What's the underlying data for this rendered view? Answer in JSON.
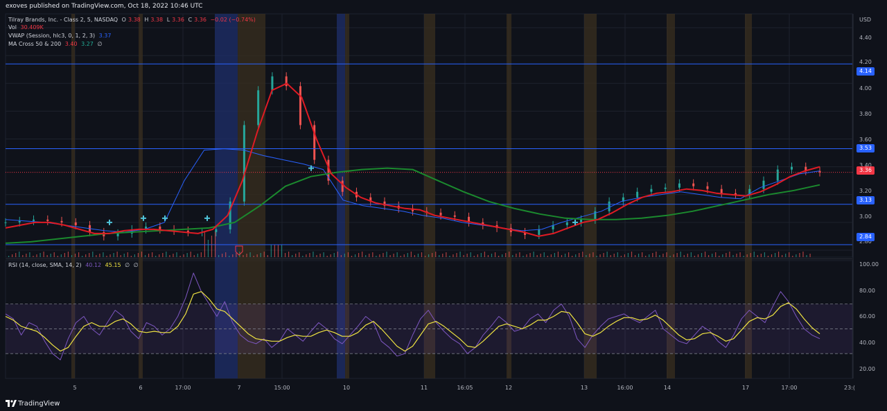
{
  "header": {
    "published": "exoves published on TradingView.com, Oct 18, 2022 10:46 UTC"
  },
  "legend": {
    "symbol": "Tilray Brands, Inc. - Class 2, 5, NASDAQ",
    "ohlc": {
      "o_label": "O",
      "o": "3.38",
      "h_label": "H",
      "h": "3.38",
      "l_label": "L",
      "l": "3.36",
      "c_label": "C",
      "c": "3.36",
      "change": "−0.02 (−0.74%)"
    },
    "vol_label": "Vol",
    "vol_value": "30.409K",
    "vwap_label": "VWAP (Session, hlc3, 0, 1, 2, 3)",
    "vwap_value": "3.37",
    "ma_label": "MA Cross 50 & 200",
    "ma_fast": "3.40",
    "ma_slow": "3.27",
    "ma_extra": "∅",
    "rsi_label": "RSI (14, close, SMA, 14, 2)",
    "rsi_value": "40.12",
    "rsi_ma": "45.15",
    "rsi_extra1": "∅",
    "rsi_extra2": "∅"
  },
  "price_axis": {
    "currency": "USD",
    "ticks": [
      "4.40",
      "4.20",
      "4.00",
      "3.80",
      "3.60",
      "3.40",
      "3.20",
      "3.00",
      "2.80"
    ],
    "badges": [
      {
        "value": "4.14",
        "color": "#2962ff"
      },
      {
        "value": "3.53",
        "color": "#2962ff"
      },
      {
        "value": "3.36",
        "color": "#f23645"
      },
      {
        "value": "3.13",
        "color": "#2962ff"
      },
      {
        "value": "2.84",
        "color": "#2962ff"
      }
    ]
  },
  "rsi_axis": {
    "ticks": [
      "100.00",
      "80.00",
      "60.00",
      "40.00",
      "20.00"
    ]
  },
  "time_axis": {
    "labels": [
      "5",
      "6",
      "17:00",
      "7",
      "15:00",
      "10",
      "11",
      "16:05",
      "12",
      "13",
      "16:00",
      "14",
      "17",
      "17:00",
      "23:("
    ]
  },
  "footer": {
    "brand": "TradingView"
  },
  "colors": {
    "background": "#0f121a",
    "grid": "#1e222d",
    "session_band": "#3a2f1f",
    "highlight_band": "#1f2f6b",
    "level_line": "#2962ff",
    "current_price": "#f23645",
    "ma_fast": "#e01b24",
    "ma_slow": "#1b8a2e",
    "vwap": "#2962ff",
    "candle_up": "#26a69a",
    "candle_down": "#ef5350",
    "rsi_line": "#7e57c2",
    "rsi_ma": "#f0e442"
  },
  "chart_data": {
    "type": "line",
    "price_levels": [
      4.14,
      3.53,
      3.13,
      2.84
    ],
    "last_price": 3.36,
    "price_range": [
      2.75,
      4.5
    ],
    "rsi_range": [
      10,
      105
    ],
    "rsi_bands": [
      30,
      70
    ],
    "close": [
      3.0,
      3.01,
      3.02,
      3.01,
      3.0,
      2.98,
      2.93,
      2.9,
      2.92,
      2.95,
      2.97,
      2.95,
      2.94,
      2.93,
      2.93,
      2.95,
      3.15,
      3.7,
      3.95,
      4.05,
      3.98,
      3.7,
      3.45,
      3.3,
      3.22,
      3.18,
      3.15,
      3.12,
      3.1,
      3.08,
      3.07,
      3.05,
      3.04,
      3.0,
      2.98,
      2.96,
      2.93,
      2.91,
      2.95,
      2.98,
      3.0,
      3.02,
      3.08,
      3.15,
      3.18,
      3.22,
      3.24,
      3.25,
      3.28,
      3.26,
      3.24,
      3.21,
      3.2,
      3.24,
      3.3,
      3.38,
      3.4,
      3.37,
      3.36
    ],
    "ma_fast": [
      2.96,
      2.98,
      3.0,
      3.0,
      2.98,
      2.95,
      2.92,
      2.92,
      2.94,
      2.95,
      2.95,
      2.94,
      2.93,
      2.92,
      2.95,
      3.05,
      3.3,
      3.65,
      3.95,
      4.0,
      3.9,
      3.6,
      3.35,
      3.25,
      3.18,
      3.14,
      3.12,
      3.1,
      3.09,
      3.05,
      3.03,
      3.01,
      2.99,
      2.97,
      2.95,
      2.93,
      2.9,
      2.92,
      2.96,
      3.0,
      3.02,
      3.07,
      3.13,
      3.18,
      3.21,
      3.22,
      3.24,
      3.23,
      3.21,
      3.2,
      3.19,
      3.22,
      3.27,
      3.33,
      3.37,
      3.4
    ],
    "ma_slow": [
      2.85,
      2.86,
      2.88,
      2.9,
      2.92,
      2.93,
      2.94,
      2.95,
      2.96,
      3.0,
      3.12,
      3.26,
      3.33,
      3.36,
      3.38,
      3.39,
      3.38,
      3.3,
      3.22,
      3.15,
      3.1,
      3.06,
      3.03,
      3.02,
      3.02,
      3.03,
      3.05,
      3.08,
      3.12,
      3.16,
      3.2,
      3.23,
      3.27
    ],
    "vwap": [
      3.02,
      3.01,
      3.0,
      2.98,
      2.96,
      2.94,
      2.93,
      2.95,
      3.0,
      3.3,
      3.52,
      3.53,
      3.52,
      3.48,
      3.45,
      3.42,
      3.38,
      3.16,
      3.12,
      3.1,
      3.08,
      3.05,
      3.03,
      3.0,
      2.98,
      2.96,
      2.94,
      2.95,
      3.0,
      3.04,
      3.08,
      3.15,
      3.18,
      3.2,
      3.22,
      3.2,
      3.18,
      3.17,
      3.25,
      3.3,
      3.35,
      3.37
    ],
    "rsi": [
      62,
      58,
      45,
      55,
      52,
      40,
      30,
      25,
      42,
      55,
      60,
      50,
      45,
      55,
      65,
      60,
      48,
      42,
      55,
      52,
      45,
      50,
      60,
      75,
      95,
      80,
      70,
      60,
      72,
      55,
      45,
      40,
      38,
      42,
      35,
      40,
      50,
      45,
      40,
      48,
      55,
      50,
      42,
      38,
      45,
      52,
      60,
      55,
      40,
      35,
      28,
      30,
      45,
      58,
      65,
      55,
      48,
      42,
      38,
      30,
      35,
      45,
      52,
      60,
      55,
      48,
      50,
      58,
      62,
      55,
      65,
      70,
      60,
      42,
      35,
      45,
      52,
      58,
      60,
      62,
      58,
      55,
      60,
      65,
      50,
      45,
      40,
      38,
      45,
      52,
      48,
      40,
      35,
      45,
      58,
      65,
      60,
      55,
      68,
      80,
      72,
      60,
      50,
      45,
      42
    ],
    "rsi_ma": [
      60,
      57,
      52,
      50,
      48,
      43,
      37,
      32,
      35,
      44,
      52,
      55,
      52,
      52,
      56,
      58,
      54,
      48,
      47,
      48,
      47,
      47,
      52,
      62,
      78,
      80,
      74,
      66,
      64,
      58,
      52,
      46,
      42,
      41,
      40,
      40,
      43,
      45,
      44,
      44,
      47,
      49,
      47,
      44,
      44,
      47,
      53,
      56,
      50,
      43,
      36,
      32,
      36,
      45,
      54,
      56,
      52,
      47,
      42,
      36,
      35,
      40,
      46,
      52,
      54,
      52,
      50,
      53,
      57,
      57,
      60,
      64,
      63,
      55,
      46,
      44,
      47,
      52,
      56,
      59,
      59,
      57,
      58,
      61,
      57,
      51,
      45,
      41,
      42,
      46,
      47,
      44,
      40,
      42,
      49,
      56,
      59,
      58,
      61,
      68,
      71,
      66,
      58,
      51,
      46
    ]
  }
}
